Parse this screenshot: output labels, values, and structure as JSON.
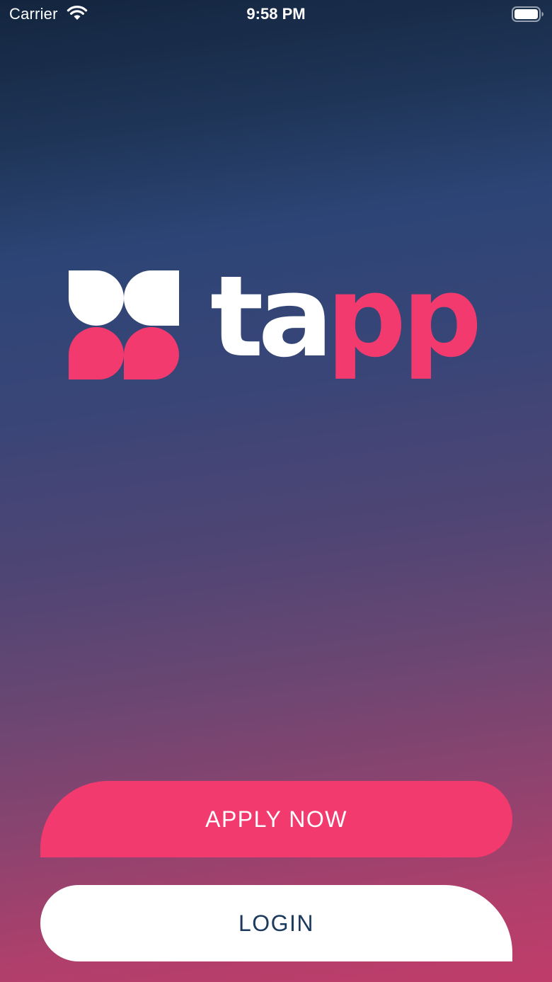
{
  "status_bar": {
    "carrier": "Carrier",
    "time": "9:58 PM",
    "icons": [
      "wifi-icon",
      "battery-icon"
    ]
  },
  "logo": {
    "text_light": "ta",
    "text_accent": "pp",
    "mark_icon": "tapp-logo-mark-icon"
  },
  "actions": {
    "apply_label": "APPLY NOW",
    "login_label": "LOGIN"
  },
  "colors": {
    "accent": "#f23a6e",
    "logo_white": "#ffffff",
    "login_text": "#1b3a5e",
    "gradient_top": "#13253e",
    "gradient_bottom": "#bf3c69"
  }
}
